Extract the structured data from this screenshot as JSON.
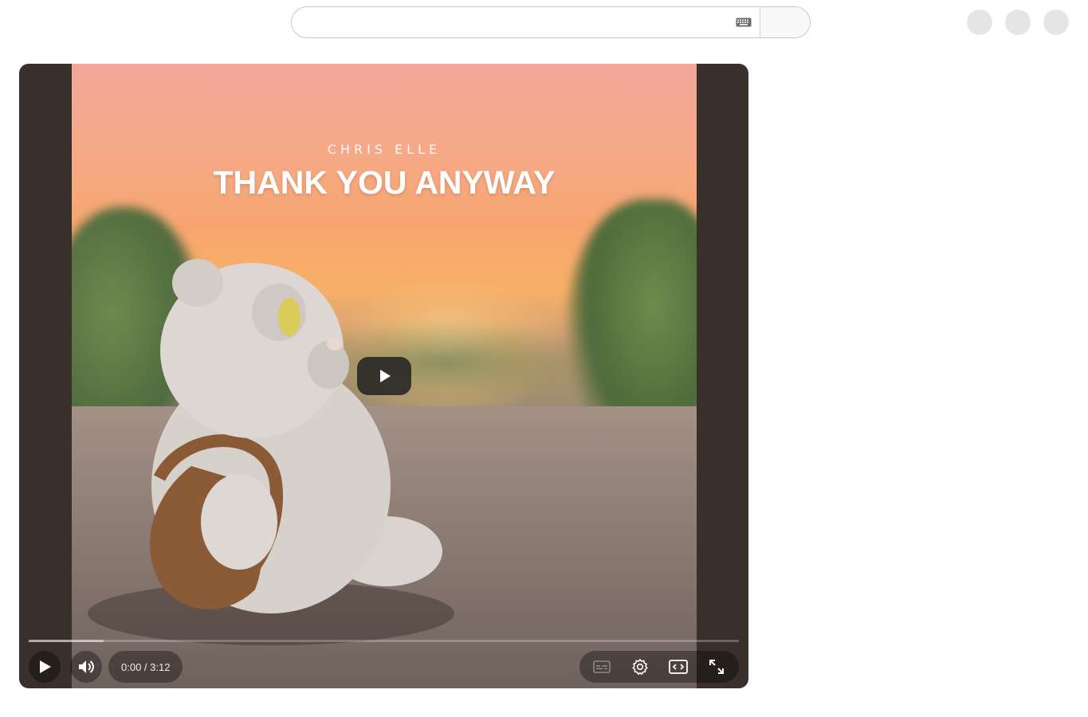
{
  "masthead": {
    "search_value": "",
    "search_placeholder": "",
    "keyboard_icon": "keyboard-icon",
    "search_button_icon": "search-icon",
    "action_circles": [
      "icon-button-1",
      "icon-button-2",
      "icon-button-3"
    ]
  },
  "player": {
    "thumbnail_artist": "CHRIS ELLE",
    "thumbnail_title": "THANK YOU ANYWAY",
    "big_play_icon": "play-icon",
    "progress_played": 0,
    "progress_buffered": 0.105,
    "controls": {
      "play_icon": "play-icon",
      "volume_icon": "volume-icon",
      "time": "0:00 / 3:12",
      "subtitles_icon": "subtitles-icon",
      "settings_icon": "settings-gear-icon",
      "theater_icon": "theater-mode-icon",
      "fullscreen_icon": "fullscreen-icon"
    }
  },
  "colors": {
    "player_background": "#3a302b",
    "progress_played": "#ff0000",
    "control_pill": "rgba(0,0,0,0.35)"
  }
}
